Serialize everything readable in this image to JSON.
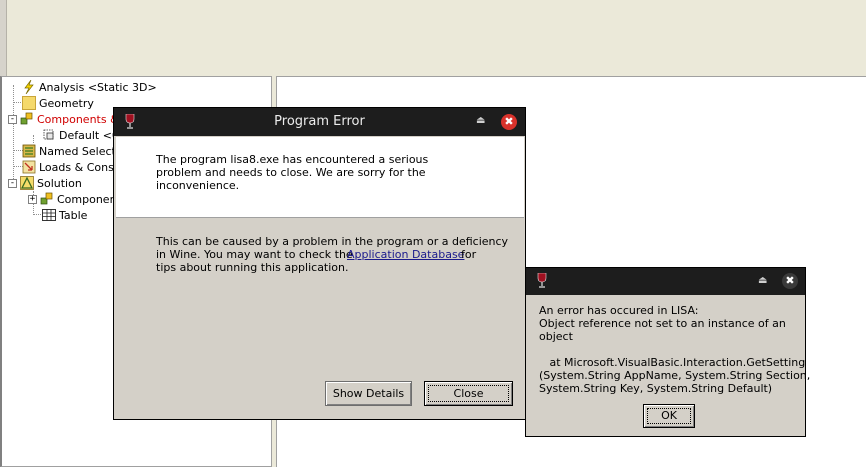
{
  "tree": {
    "items": [
      {
        "label": "Analysis <Static 3D>"
      },
      {
        "label": "Geometry"
      },
      {
        "label": "Components &"
      },
      {
        "label": "Default <0"
      },
      {
        "label": "Named Selectio"
      },
      {
        "label": "Loads & Constr"
      },
      {
        "label": "Solution"
      },
      {
        "label": "Component"
      },
      {
        "label": "Table"
      }
    ],
    "expanders": [
      "-",
      "-",
      "+"
    ]
  },
  "program_error": {
    "title": "Program Error",
    "message": "The program lisa8.exe has encountered a serious\nproblem and needs to close. We are sorry for the\ninconvenience.",
    "info_line1": "This can be caused by a problem in the program or a deficiency",
    "info_line2a": "in Wine. You may want to check the",
    "link_text": "Application Database",
    "info_line2b": "for",
    "info_line3": "tips about running this application.",
    "show_details_label": "Show Details",
    "close_label": "Close",
    "shade_icon": "⏏",
    "close_icon": "✖"
  },
  "lisa_error": {
    "message": "An error has occured in LISA:\nObject reference not set to an instance of an\nobject\n\n   at Microsoft.VisualBasic.Interaction.GetSetting\n(System.String AppName, System.String Section,\nSystem.String Key, System.String Default)",
    "ok_label": "OK",
    "shade_icon": "⏏",
    "close_icon": "✖"
  },
  "colors": {
    "titlebar": "#1d1d1d",
    "dialog_bg": "#d4d0c8",
    "close_red": "#d9322b",
    "close_dark": "#3a3a3a",
    "wine": "#a01020"
  }
}
